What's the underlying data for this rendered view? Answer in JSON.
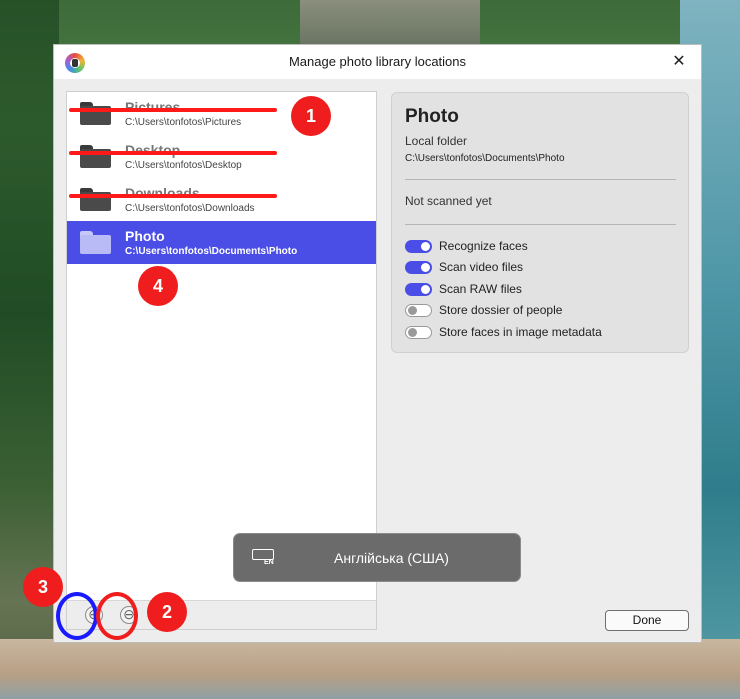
{
  "window": {
    "title": "Manage photo library locations"
  },
  "locations": [
    {
      "name": "Pictures",
      "path": "C:\\Users\\tonfotos\\Pictures"
    },
    {
      "name": "Desktop",
      "path": "C:\\Users\\tonfotos\\Desktop"
    },
    {
      "name": "Downloads",
      "path": "C:\\Users\\tonfotos\\Downloads"
    },
    {
      "name": "Photo",
      "path": "C:\\Users\\tonfotos\\Documents\\Photo"
    }
  ],
  "details": {
    "title": "Photo",
    "type": "Local folder",
    "path": "C:\\Users\\tonfotos\\Documents\\Photo",
    "status": "Not scanned yet",
    "options": [
      {
        "label": "Recognize faces",
        "on": true
      },
      {
        "label": "Scan video files",
        "on": true
      },
      {
        "label": "Scan RAW files",
        "on": true
      },
      {
        "label": "Store dossier of people",
        "on": false
      },
      {
        "label": "Store faces in image metadata",
        "on": false
      }
    ]
  },
  "buttons": {
    "done": "Done",
    "add": "⊕",
    "remove": "⊖",
    "close": "✕"
  },
  "toast": {
    "text": "Англійська (США)",
    "badge": "EN"
  },
  "markers": {
    "m1": "1",
    "m2": "2",
    "m3": "3",
    "m4": "4"
  },
  "colors": {
    "accent": "#4a4ee6",
    "annotation_red": "#ef1d1d",
    "annotation_blue": "#1a1aff"
  }
}
